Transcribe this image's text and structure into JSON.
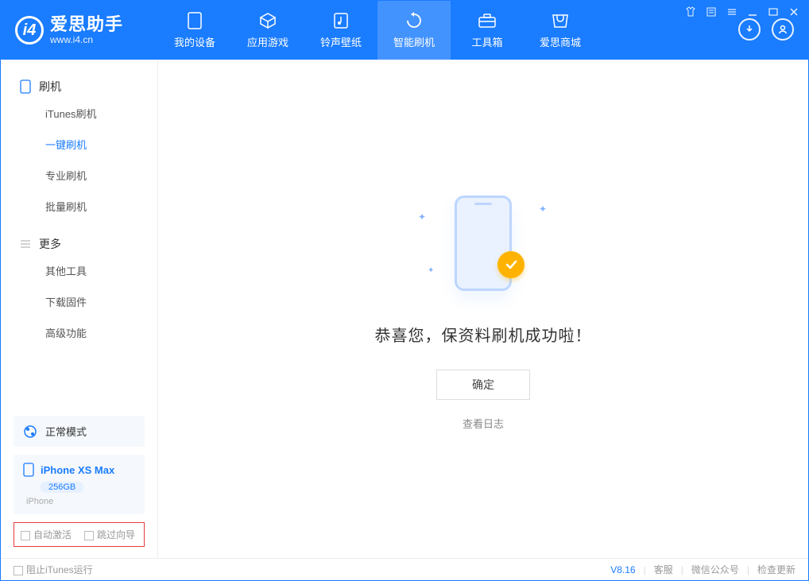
{
  "brand": {
    "title": "爱思助手",
    "url": "www.i4.cn"
  },
  "tabs": [
    {
      "label": "我的设备"
    },
    {
      "label": "应用游戏"
    },
    {
      "label": "铃声壁纸"
    },
    {
      "label": "智能刷机"
    },
    {
      "label": "工具箱"
    },
    {
      "label": "爱思商城"
    }
  ],
  "sidebar": {
    "section1": "刷机",
    "items1": [
      "iTunes刷机",
      "一键刷机",
      "专业刷机",
      "批量刷机"
    ],
    "section2": "更多",
    "items2": [
      "其他工具",
      "下载固件",
      "高级功能"
    ]
  },
  "mode": {
    "label": "正常模式"
  },
  "device": {
    "name": "iPhone XS Max",
    "storage": "256GB",
    "type": "iPhone"
  },
  "options": {
    "auto_activate": "自动激活",
    "skip_guide": "跳过向导"
  },
  "main": {
    "success": "恭喜您，保资料刷机成功啦！",
    "ok": "确定",
    "view_log": "查看日志"
  },
  "status": {
    "block_itunes": "阻止iTunes运行",
    "version": "V8.16",
    "support": "客服",
    "wechat": "微信公众号",
    "update": "检查更新"
  }
}
